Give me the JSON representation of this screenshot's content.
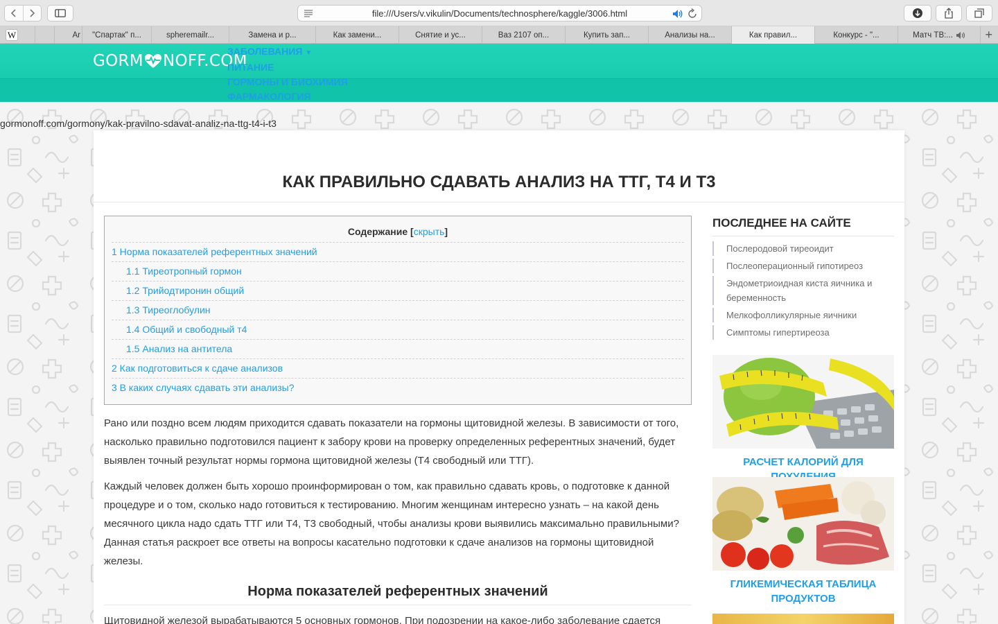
{
  "browser": {
    "url": "file:///Users/v.vikulin/Documents/technosphere/kaggle/3006.html",
    "tabs": [
      {
        "label": "W",
        "active": false
      },
      {
        "label": "",
        "active": false
      },
      {
        "label": "Ar",
        "active": false
      },
      {
        "label": "\"Спартак\" п...",
        "active": false
      },
      {
        "label": "spheremailr...",
        "active": false
      },
      {
        "label": "Замена и р...",
        "active": false
      },
      {
        "label": "Как замени...",
        "active": false
      },
      {
        "label": "Снятие и ус...",
        "active": false
      },
      {
        "label": "Ваз 2107 оп...",
        "active": false
      },
      {
        "label": "Купить зап...",
        "active": false
      },
      {
        "label": "Анализы на...",
        "active": false
      },
      {
        "label": "Как правил...",
        "active": true
      },
      {
        "label": "Конкурс - \"...",
        "active": false
      },
      {
        "label": "Матч ТВ:...",
        "active": false
      }
    ]
  },
  "site": {
    "logo_left": "GORM",
    "logo_right": "NOFF.COM",
    "menu": [
      {
        "label": "Заболевания",
        "has_dropdown": true
      },
      {
        "label": "Питание",
        "has_dropdown": false
      },
      {
        "label": "Гормоны и биохимия",
        "has_dropdown": false
      },
      {
        "label": "Фармакология",
        "has_dropdown": false
      }
    ],
    "page_url": "gormonoff.com/gormony/kak-pravilno-sdavat-analiz-na-ttg-t4-i-t3"
  },
  "article": {
    "title": "КАК ПРАВИЛЬНО СДАВАТЬ АНАЛИЗ НА ТТГ, Т4 И Т3",
    "toc_title": "Содержание",
    "toc_toggle": "скрыть",
    "toc": [
      {
        "label": "1 Норма показателей референтных значений",
        "level": 1
      },
      {
        "label": "1.1 Тиреотропный гормон",
        "level": 2
      },
      {
        "label": "1.2 Трийодтиронин общий",
        "level": 2
      },
      {
        "label": "1.3 Тиреоглобулин",
        "level": 2
      },
      {
        "label": "1.4 Общий и свободный т4",
        "level": 2
      },
      {
        "label": "1.5 Анализ на антитела",
        "level": 2
      },
      {
        "label": "2 Как подготовиться к сдаче анализов",
        "level": 1
      },
      {
        "label": "3 В каких случаях сдавать эти анализы?",
        "level": 1
      }
    ],
    "paragraphs": [
      "Рано или поздно всем людям приходится сдавать показатели на гормоны щитовидной железы. В зависимости от того, насколько правильно подготовился пациент к забору крови на проверку определенных референтных значений, будет выявлен точный результат нормы гормона щитовидной железы (Т4 свободный или ТТГ).",
      "Каждый человек должен быть хорошо проинформирован о том, как правильно сдавать кровь, о подготовке к данной процедуре и о том, сколько надо готовиться к тестированию. Многим женщинам интересно узнать – на какой день месячного цикла надо сдать ТТГ или Т4, Т3 свободный, чтобы анализы крови выявились максимально правильными? Данная статья раскроет все ответы на вопросы касательно подготовки к сдаче анализов на гормоны щитовидной железы."
    ],
    "section_heading": "Норма показателей референтных значений",
    "section_text": "Щитовидной железой вырабатываются 5 основных гормонов. При подозрении на какое-либо заболевание сдается"
  },
  "sidebar": {
    "heading": "ПОСЛЕДНЕЕ НА САЙТЕ",
    "latest": [
      "Послеродовой тиреоидит",
      "Послеоперационный гипотиреоз",
      "Эндометриоидная киста яичника и беременность",
      "Мелкофолликулярные яичники",
      "Симптомы гипертиреоза"
    ],
    "promos": [
      "РАСЧЕТ КАЛОРИЙ ДЛЯ ПОХУДЕНИЯ",
      "ГЛИКЕМИЧЕСКАЯ ТАБЛИЦА ПРОДУКТОВ"
    ]
  },
  "colors": {
    "header": "#17c8ad",
    "link": "#1e9fe8",
    "text": "#3a3a3a"
  }
}
